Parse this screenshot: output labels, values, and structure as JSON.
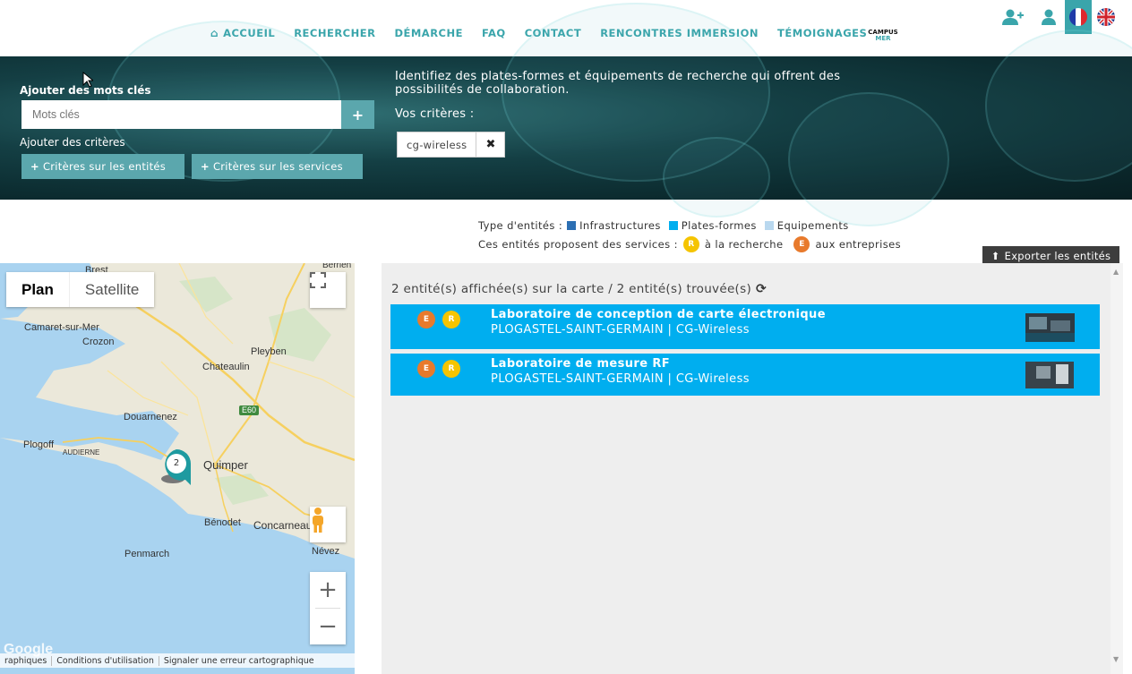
{
  "nav": {
    "items": [
      "ACCUEIL",
      "RECHERCHER",
      "DÉMARCHE",
      "FAQ",
      "CONTACT",
      "RENCONTRES IMMERSION",
      "TÉMOIGNAGES"
    ],
    "logo_top": "CAMPUS",
    "logo_bottom": "MER",
    "icons": [
      "user-plus-icon",
      "user-icon",
      "flag-fr-icon",
      "flag-uk-icon"
    ]
  },
  "search": {
    "keywords_label": "Ajouter des mots clés",
    "keywords_placeholder": "Mots clés",
    "criteria_label": "Ajouter des critères",
    "btn_entities": "Critères sur les entités",
    "btn_services": "Critères sur les services",
    "intro": "Identifiez des plates-formes et équipements de recherche qui offrent des possibilités de collaboration.",
    "criteria_title": "Vos critères :",
    "tag": "cg-wireless"
  },
  "legend": {
    "type_label": "Type d'entités :",
    "types": [
      {
        "label": "Infrastructures",
        "color": "#2c6fb3"
      },
      {
        "label": "Plates-formes",
        "color": "#00aeef"
      },
      {
        "label": "Equipements",
        "color": "#b9d8ef"
      }
    ],
    "services_label": "Ces entités proposent des services :",
    "services": [
      {
        "badge": "R",
        "label": "à la recherche",
        "color": "#f5c400"
      },
      {
        "badge": "E",
        "label": "aux entreprises",
        "color": "#e87a2c"
      }
    ],
    "export": "Exporter les entités"
  },
  "map": {
    "type_plan": "Plan",
    "type_satellite": "Satellite",
    "cluster_count": "2",
    "labels": [
      "Brest",
      "Berrien",
      "Camaret-sur-Mer",
      "Crozon",
      "Pleyben",
      "Chateaulin",
      "E60",
      "Douarnenez",
      "Plogoff",
      "AUDIERNE",
      "Quimper",
      "Bénodet",
      "Concarneau",
      "Névez",
      "Penmarch",
      "Google"
    ],
    "footer": [
      "raphiques",
      "Conditions d'utilisation",
      "Signaler une erreur cartographique"
    ]
  },
  "results": {
    "count": "2 entité(s) affichée(s) sur la carte / 2 entité(s) trouvée(s)",
    "items": [
      {
        "title": "Laboratoire de conception de carte électronique",
        "subtitle": "PLOGASTEL-SAINT-GERMAIN | CG-Wireless",
        "badges": [
          "E",
          "R"
        ]
      },
      {
        "title": "Laboratoire de mesure RF",
        "subtitle": "PLOGASTEL-SAINT-GERMAIN | CG-Wireless",
        "badges": [
          "E",
          "R"
        ]
      }
    ]
  }
}
